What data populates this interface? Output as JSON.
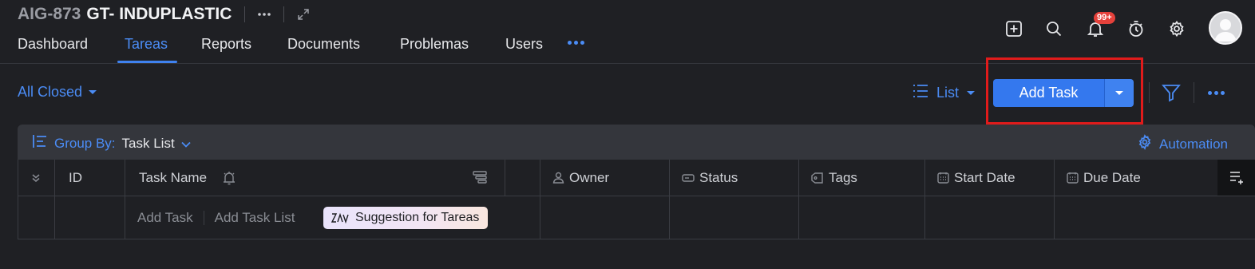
{
  "project": {
    "id": "AIG-873",
    "name": "GT- INDUPLASTIC"
  },
  "tabs": [
    {
      "label": "Dashboard",
      "active": false
    },
    {
      "label": "Tareas",
      "active": true
    },
    {
      "label": "Reports",
      "active": false
    },
    {
      "label": "Documents",
      "active": false
    },
    {
      "label": "Problemas",
      "active": false
    },
    {
      "label": "Users",
      "active": false
    }
  ],
  "header": {
    "notifications_badge": "99+",
    "icons": [
      "plus-square-icon",
      "search-icon",
      "bell-icon",
      "timer-icon",
      "gear-icon",
      "avatar"
    ]
  },
  "toolbar": {
    "filter_label": "All Closed",
    "view_label": "List",
    "add_task_label": "Add Task"
  },
  "group_bar": {
    "group_by_label": "Group By:",
    "group_by_value": "Task List",
    "automation_label": "Automation"
  },
  "table": {
    "columns": {
      "id": "ID",
      "task_name": "Task Name",
      "owner": "Owner",
      "status": "Status",
      "tags": "Tags",
      "start_date": "Start Date",
      "due_date": "Due Date"
    },
    "row": {
      "add_task": "Add Task",
      "add_task_list": "Add Task List",
      "suggestion": "Suggestion for Tareas"
    }
  },
  "colors": {
    "background": "#1f2024",
    "accent": "#4b8cf5",
    "primary_button": "#3478ee",
    "badge": "#e5413b",
    "highlight_box": "#e01b1b"
  }
}
